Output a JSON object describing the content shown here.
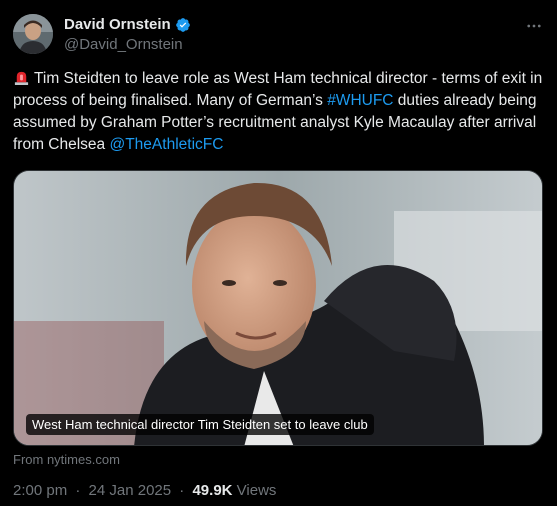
{
  "author": {
    "display_name": "David Ornstein",
    "handle": "@David_Ornstein",
    "verified_color": "#1d9bf0"
  },
  "tweet": {
    "segments": [
      {
        "text": "Tim Steidten to leave role as West Ham technical director - terms of exit in process of being finalised. Many of German’s ",
        "link": false
      },
      {
        "text": "#WHUFC",
        "link": true
      },
      {
        "text": " duties already being assumed by Graham Potter’s recruitment analyst Kyle Macaulay after arrival from Chelsea ",
        "link": false
      },
      {
        "text": "@TheAthleticFC",
        "link": true
      }
    ],
    "leading_icon": "siren-icon"
  },
  "card": {
    "caption": "West Ham technical director Tim Steidten set to leave club",
    "source": "From nytimes.com"
  },
  "meta": {
    "time": "2:00 pm",
    "date": "24 Jan 2025",
    "views_count": "49.9K",
    "views_label": "Views"
  },
  "colors": {
    "background": "#000000",
    "text": "#e7e9ea",
    "muted": "#71767b",
    "link": "#1d9bf0"
  }
}
